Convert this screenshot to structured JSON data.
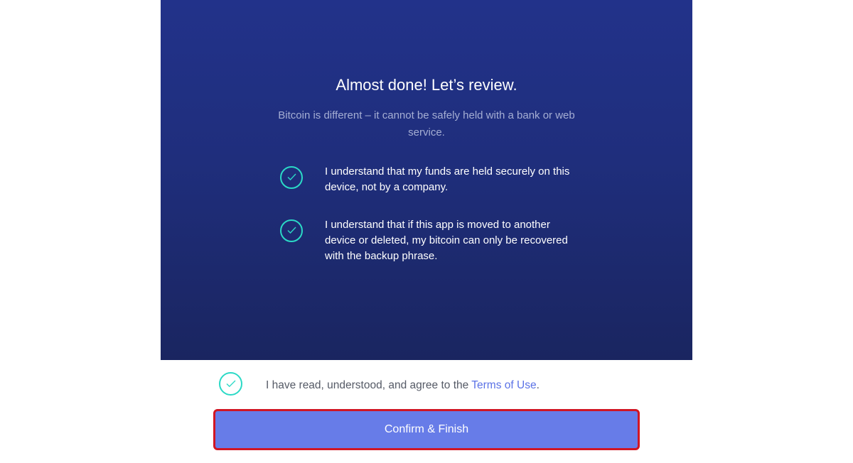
{
  "review": {
    "title": "Almost done! Let’s review.",
    "subtitle": "Bitcoin is different – it cannot be safely held with a bank or web service.",
    "items": [
      {
        "text": "I understand that my funds are held securely on this device, not by a company.",
        "checked": true
      },
      {
        "text": "I understand that if this app is moved to another device or deleted, my bitcoin can only be recovered with the backup phrase.",
        "checked": true
      }
    ]
  },
  "agreement": {
    "prefix": "I have read, understood, and agree to the ",
    "link_text": "Terms of Use",
    "suffix": ".",
    "checked": true
  },
  "confirm_button": {
    "label": "Confirm & Finish"
  },
  "colors": {
    "panel_top": "#22328a",
    "panel_bottom": "#1a2560",
    "check_accent": "#2bd9c6",
    "button": "#677ce8",
    "highlight_border": "#d11624",
    "link": "#5b72e6"
  }
}
